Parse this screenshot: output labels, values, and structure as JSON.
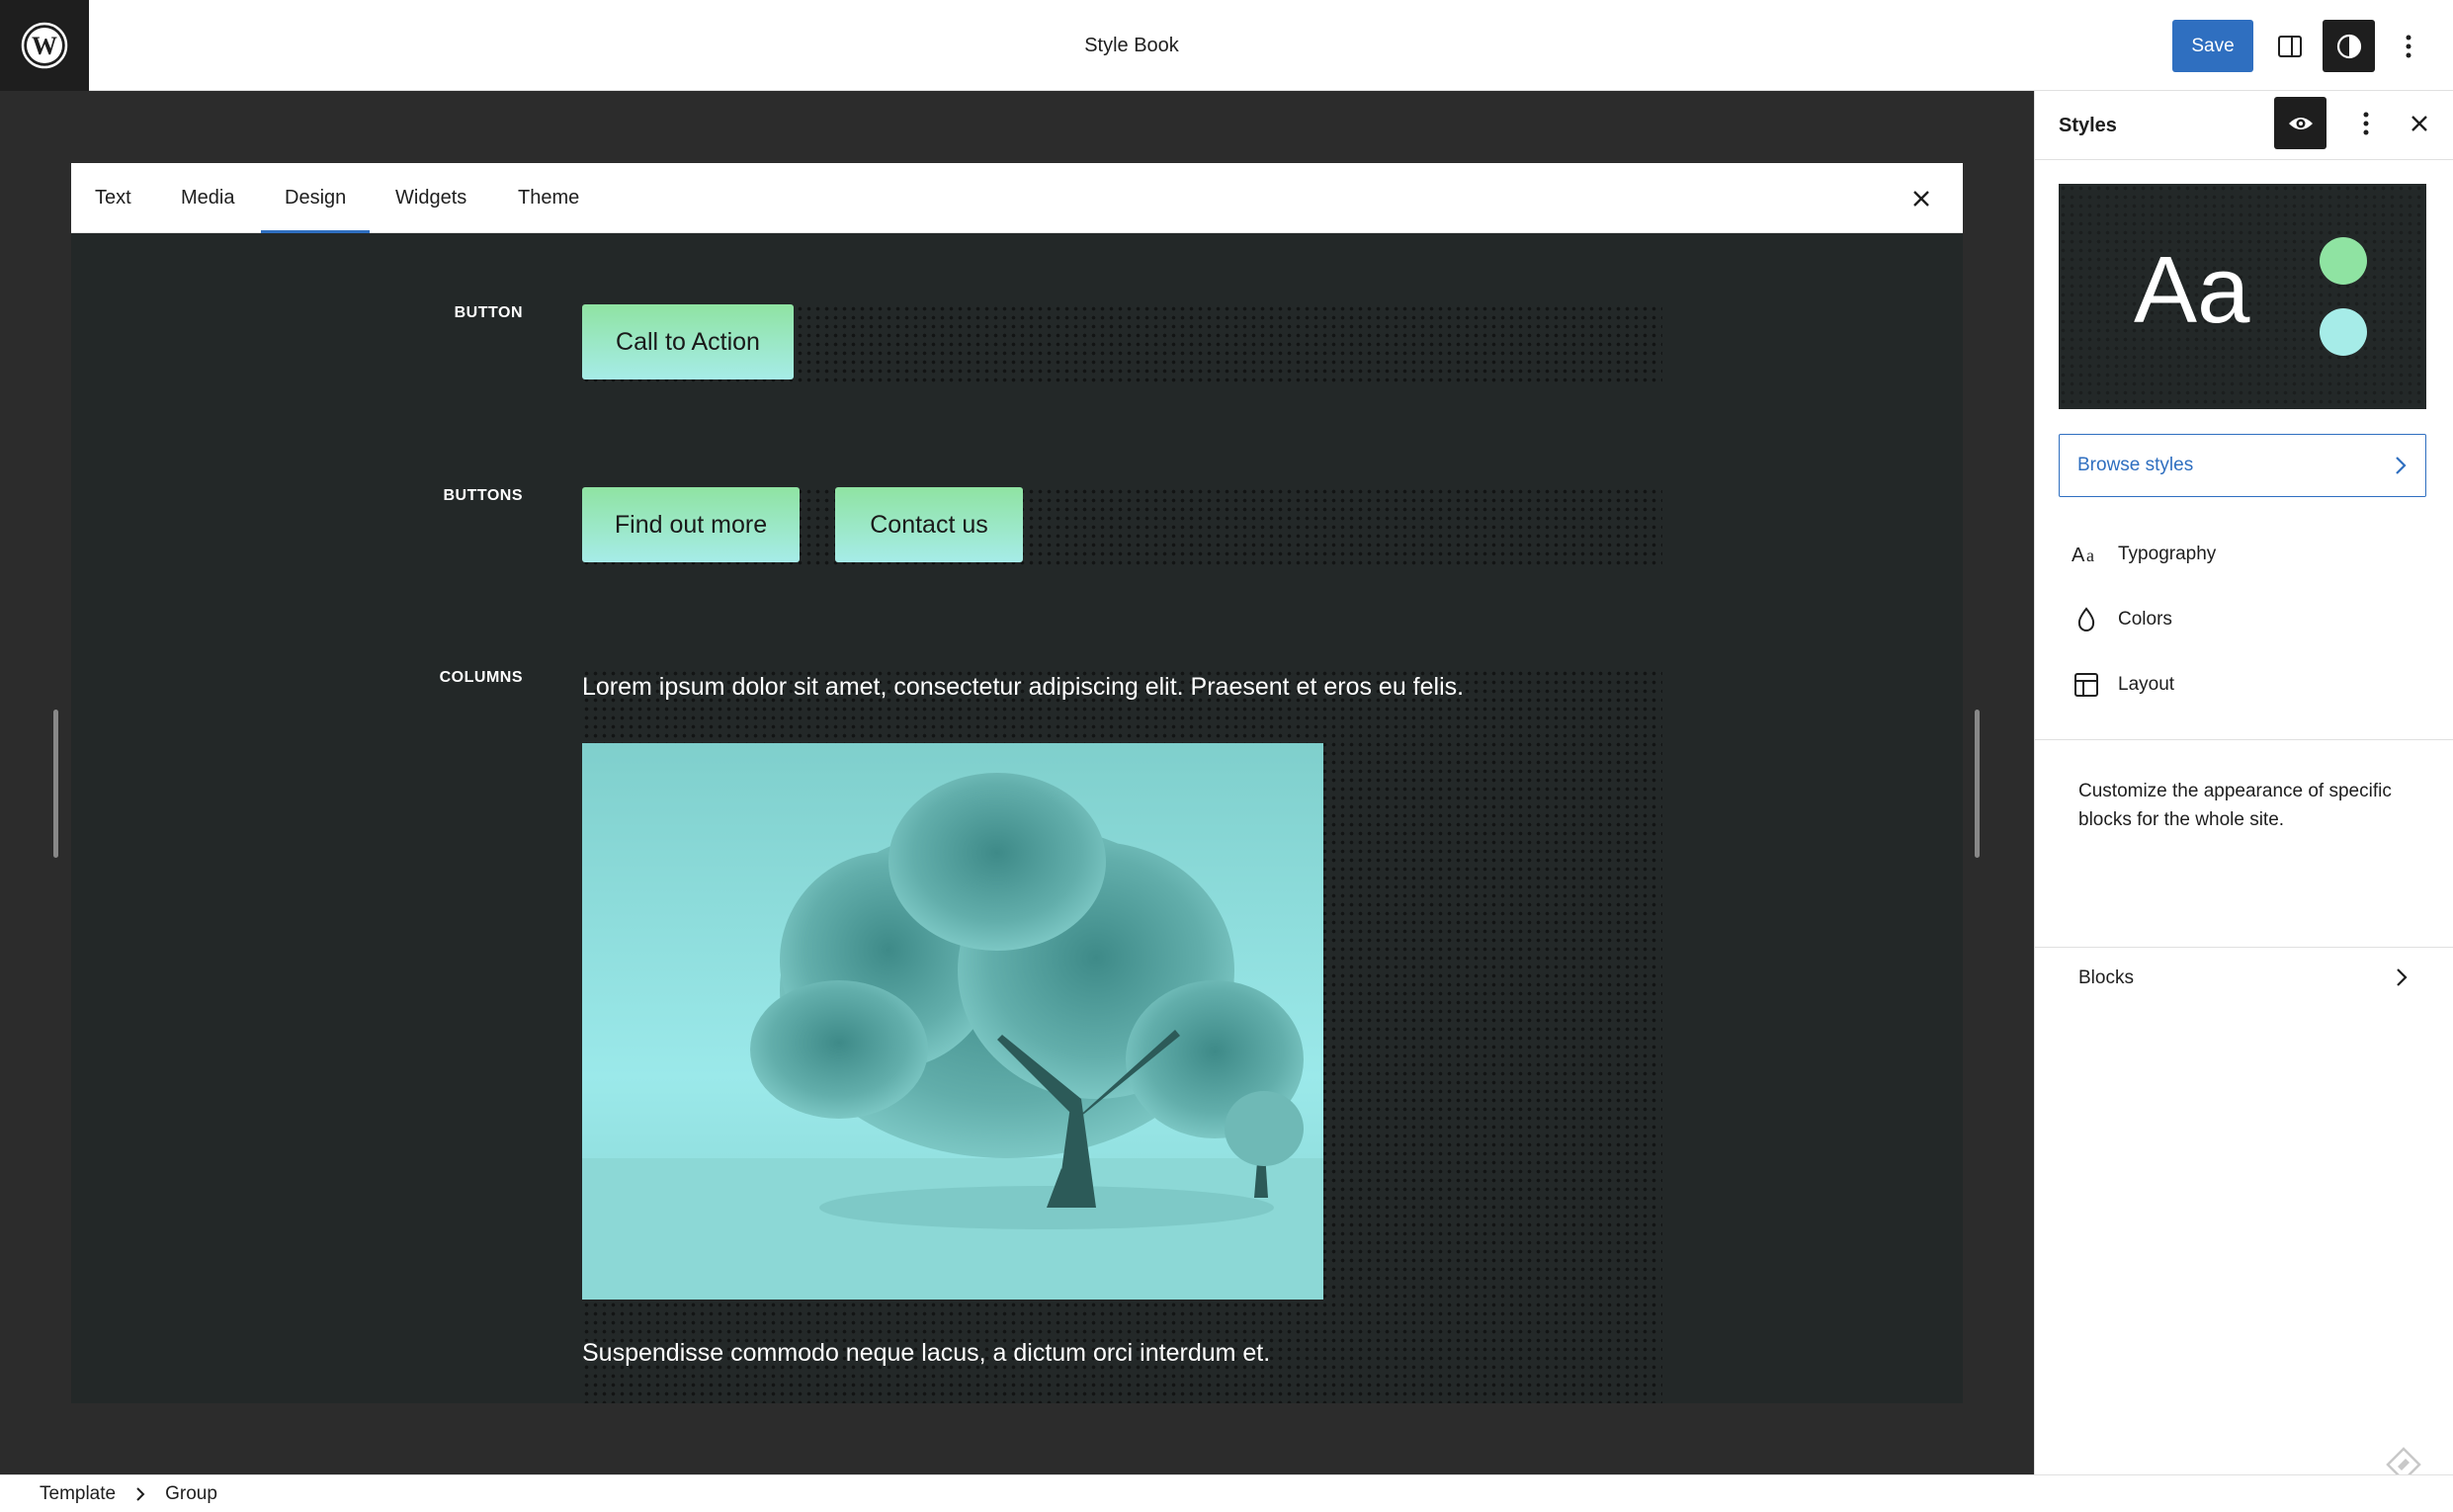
{
  "header": {
    "title": "Style Book",
    "save_label": "Save"
  },
  "stylebook": {
    "tabs": [
      {
        "label": "Text"
      },
      {
        "label": "Media"
      },
      {
        "label": "Design",
        "active": true
      },
      {
        "label": "Widgets"
      },
      {
        "label": "Theme"
      }
    ],
    "rows": {
      "button": {
        "label": "BUTTON",
        "buttons": [
          "Call to Action"
        ]
      },
      "buttons": {
        "label": "BUTTONS",
        "buttons": [
          "Find out more",
          "Contact us"
        ]
      },
      "columns": {
        "label": "COLUMNS",
        "text1": "Lorem ipsum dolor sit amet, consectetur adipiscing elit. Praesent et eros eu felis.",
        "text2": "Suspendisse commodo neque lacus, a dictum orci interdum et."
      }
    }
  },
  "panel": {
    "title": "Styles",
    "preview": {
      "aa": "Aa",
      "dot_colors": [
        "#8fe3a2",
        "#a6ece8"
      ]
    },
    "browse_label": "Browse styles",
    "nav": [
      {
        "label": "Typography",
        "icon": "typography-icon"
      },
      {
        "label": "Colors",
        "icon": "droplet-icon"
      },
      {
        "label": "Layout",
        "icon": "layout-icon"
      }
    ],
    "blocks_desc": "Customize the appearance of specific blocks for the whole site.",
    "blocks_label": "Blocks"
  },
  "breadcrumb": [
    "Template",
    "Group"
  ],
  "colors": {
    "accent": "#2f6fc0",
    "button_gradient_start": "#8fe3a2",
    "button_gradient_end": "#a6ece8",
    "canvas_bg": "#232828"
  }
}
